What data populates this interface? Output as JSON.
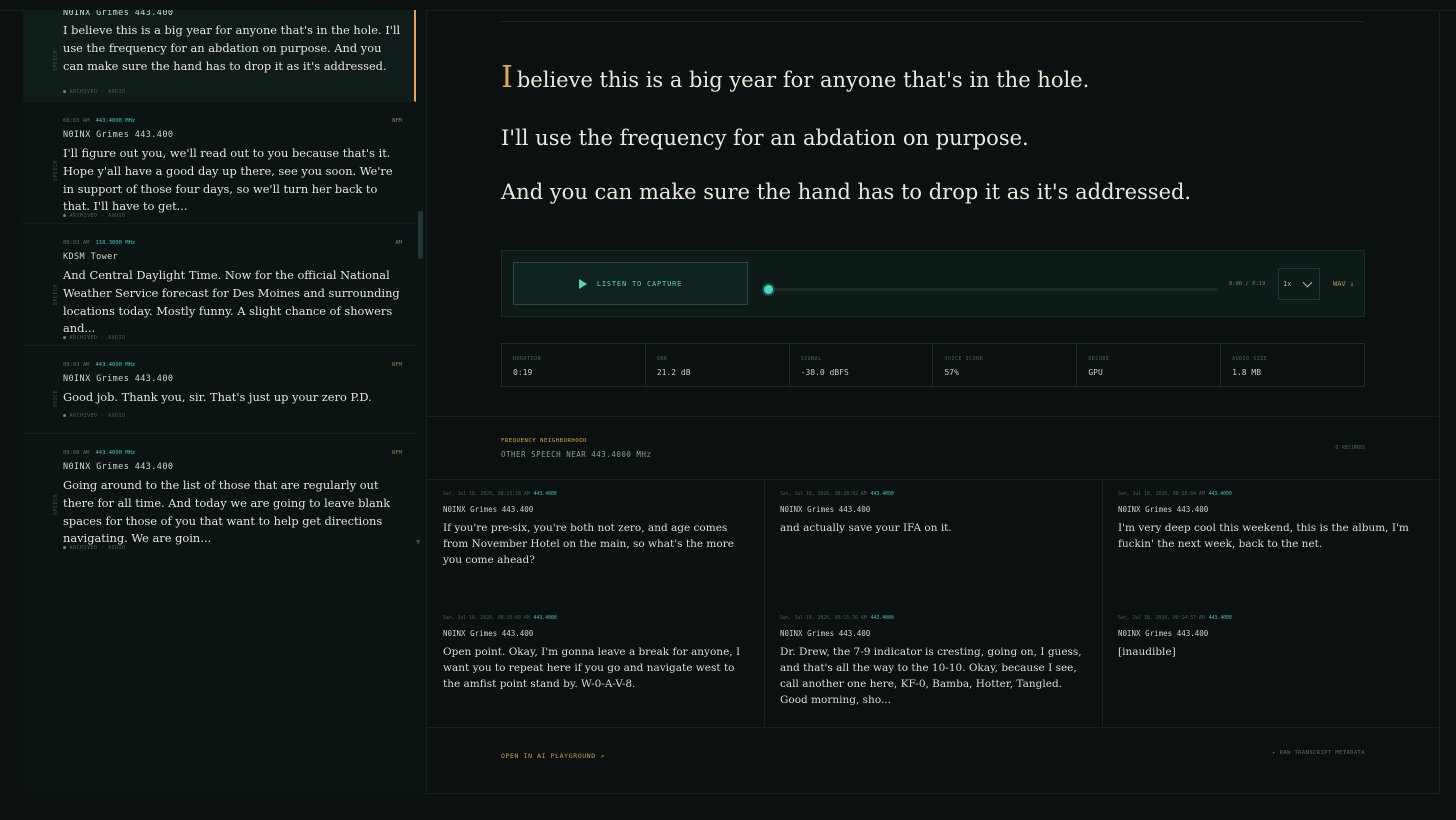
{
  "sidebar": {
    "cards": [
      {
        "rail": "SPEECH",
        "time": "",
        "freq": "",
        "band": "",
        "station": "N0INX Grimes 443.400",
        "text": "I believe this is a big year for anyone that's in the hole. I'll use the frequency for an abdation on purpose. And you can make sure the hand has to drop it as it's addressed.",
        "status": "ARCHIVED · AUDIO"
      },
      {
        "rail": "SPEECH",
        "time": "08:03 AM",
        "freq": "443.4000 MHz",
        "band": "NFM",
        "station": "N0INX Grimes 443.400",
        "text": "I'll figure out you, we'll read out to you because that's it. Hope y'all have a good day up there, see you soon. We're in support of those four days, so we'll turn her back to that. I'll have to get...",
        "status": "ARCHIVED · AUDIO"
      },
      {
        "rail": "SPEECH",
        "time": "08:03 AM",
        "freq": "118.3000 MHz",
        "band": "AM",
        "station": "KDSM Tower",
        "text": "And Central Daylight Time. Now for the official National Weather Service forecast for Des Moines and surrounding locations today. Mostly funny. A slight chance of showers and...",
        "status": "ARCHIVED · AUDIO"
      },
      {
        "rail": "VOICE",
        "time": "08:03 AM",
        "freq": "443.4000 MHz",
        "band": "NFM",
        "station": "N0INX Grimes 443.400",
        "text": "Good job. Thank you, sir. That's just up your zero P.D.",
        "status": "ARCHIVED · AUDIO"
      },
      {
        "rail": "SPEECH",
        "time": "08:00 AM",
        "freq": "443.4000 MHz",
        "band": "NFM",
        "station": "N0INX Grimes 443.400",
        "text": "Going around to the list of those that are regularly out there for all time. And today we are going to leave blank spaces for those of you that want to help get directions navigating. We are goin...",
        "status": "ARCHIVED · AUDIO"
      }
    ]
  },
  "transcript": {
    "dropcap": "I",
    "line1_rest": "believe this is a big year for anyone that's in the hole.",
    "line2": "I'll use the frequency for an abdation on purpose.",
    "line3": "And you can make sure the hand has to drop it as it's addressed."
  },
  "player": {
    "listen_label": "LISTEN TO CAPTURE",
    "time": "0:00 / 0:19",
    "progress": 0,
    "speed": "1x",
    "wav_label": "WAV ↓"
  },
  "stats": [
    {
      "label": "DURATION",
      "value": "0:19"
    },
    {
      "label": "SNR",
      "value": "21.2 dB"
    },
    {
      "label": "SIGNAL",
      "value": "-38.0 dBFS"
    },
    {
      "label": "VOICE SCORE",
      "value": "57%"
    },
    {
      "label": "DECODE",
      "value": "GPU"
    },
    {
      "label": "AUDIO SIZE",
      "value": "1.8 MB"
    }
  ],
  "neighborhood": {
    "kicker": "FREQUENCY NEIGHBORHOOD",
    "title": "OTHER SPEECH NEAR 443.4000 MHz",
    "count": "6 RECORDS",
    "items": [
      {
        "meta": "Sat, Jul 18, 2026, 08:23:16 AM",
        "freq": "443.4000",
        "station": "N0INX Grimes 443.400",
        "text": "If you're pre-six, you're both not zero, and age comes from November Hotel on the main, so what's the more you come ahead?"
      },
      {
        "meta": "Sat, Jul 18, 2026, 08:20:02 AM",
        "freq": "443.4000",
        "station": "N0INX Grimes 443.400",
        "text": "and actually save your IFA on it."
      },
      {
        "meta": "Sat, Jul 18, 2026, 08:18:04 AM",
        "freq": "443.4000",
        "station": "N0INX Grimes 443.400",
        "text": "I'm very deep cool this weekend, this is the album, I'm fuckin' the next week, back to the net."
      },
      {
        "meta": "Sat, Jul 18, 2026, 08:16:09 AM",
        "freq": "443.4000",
        "station": "N0INX Grimes 443.400",
        "text": "Open point. Okay, I'm gonna leave a break for anyone, I want you to repeat here if you go and navigate west to the amfist point stand by. W-0-A-V-8."
      },
      {
        "meta": "Sat, Jul 18, 2026, 08:15:36 AM",
        "freq": "443.4000",
        "station": "N0INX Grimes 443.400",
        "text": "Dr. Drew, the 7-9 indicator is cresting, going on, I guess, and that's all the way to the 10-10. Okay, because I see, call another one here, KF-0, Bamba, Hotter, Tangled. Good morning, sho..."
      },
      {
        "meta": "Sat, Jul 18, 2026, 08:14:57 AM",
        "freq": "443.4000",
        "station": "N0INX Grimes 443.400",
        "text": "[inaudible]"
      }
    ]
  },
  "footer": {
    "playground": "OPEN IN AI PLAYGROUND ↗",
    "raw": "▸ RAW TRANSCRIPT METADATA"
  }
}
